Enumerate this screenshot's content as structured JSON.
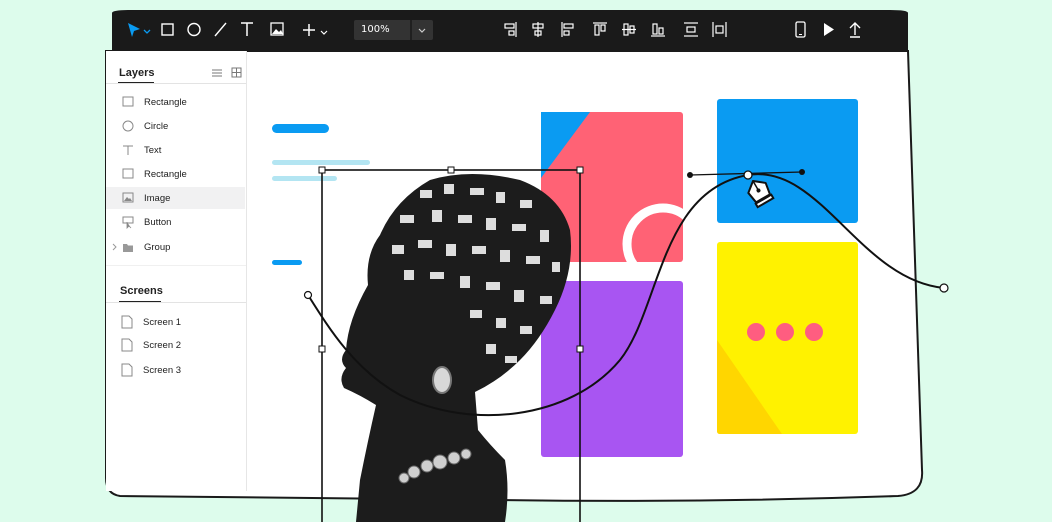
{
  "toolbar": {
    "zoom_value": "100%",
    "tools": [
      "select-tool",
      "rectangle-tool",
      "ellipse-tool",
      "line-tool",
      "text-tool",
      "image-tool",
      "add-tool"
    ],
    "align_tools": [
      "align-right",
      "align-center-horizontal",
      "align-left",
      "align-top",
      "align-center-vertical",
      "align-bottom",
      "distribute-vertical",
      "distribute-horizontal"
    ],
    "right_tools": [
      "device-preview",
      "play",
      "export"
    ]
  },
  "layers_panel": {
    "title": "Layers",
    "items": [
      {
        "label": "Rectangle",
        "icon": "rectangle-icon"
      },
      {
        "label": "Circle",
        "icon": "circle-icon"
      },
      {
        "label": "Text",
        "icon": "text-icon"
      },
      {
        "label": "Rectangle",
        "icon": "rectangle-icon"
      },
      {
        "label": "Image",
        "icon": "image-icon",
        "selected": true
      },
      {
        "label": "Button",
        "icon": "button-icon"
      },
      {
        "label": "Group",
        "icon": "folder-icon"
      }
    ]
  },
  "screens_panel": {
    "title": "Screens",
    "items": [
      {
        "label": "Screen 1"
      },
      {
        "label": "Screen 2"
      },
      {
        "label": "Screen 3"
      }
    ]
  },
  "colors": {
    "background": "#ddfcec",
    "toolbar": "#1a1a1a",
    "accent_blue": "#0a9bf2",
    "coral": "#ff6275",
    "purple": "#a855f2",
    "yellow": "#fff200",
    "dot_pink": "#ff5d80",
    "light_cyan": "#b3e5f2"
  }
}
